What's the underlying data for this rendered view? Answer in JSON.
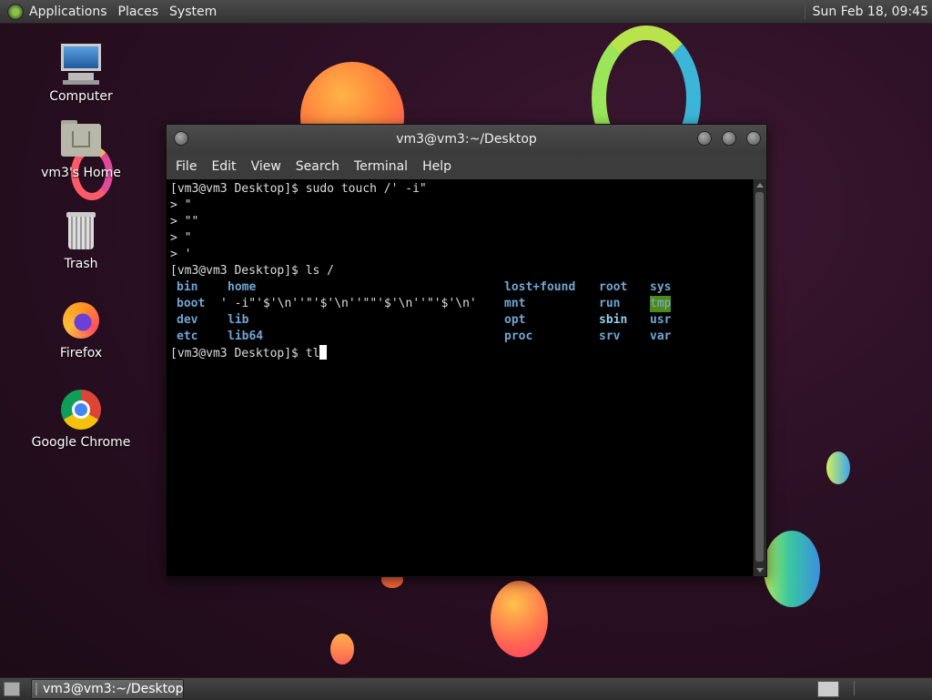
{
  "top_panel": {
    "menus": [
      "Applications",
      "Places",
      "System"
    ],
    "clock": "Sun Feb 18, 09:45"
  },
  "desktop_icons": [
    {
      "label": "Computer",
      "icon": "computer-icon"
    },
    {
      "label": "vm3's Home",
      "icon": "home-folder-icon"
    },
    {
      "label": "Trash",
      "icon": "trash-icon"
    },
    {
      "label": "Firefox",
      "icon": "firefox-icon"
    },
    {
      "label": "Google Chrome",
      "icon": "chrome-icon"
    }
  ],
  "terminal": {
    "title": "vm3@vm3:~/Desktop",
    "menu": [
      "File",
      "Edit",
      "View",
      "Search",
      "Terminal",
      "Help"
    ],
    "lines": [
      "[vm3@vm3 Desktop]$ sudo touch /' -i\"",
      "> \"",
      "> \"\"",
      "> \"",
      "> '",
      "[vm3@vm3 Desktop]$ ls /"
    ],
    "ls_output": {
      "col1": [
        "bin",
        "boot",
        "dev",
        "etc"
      ],
      "col2": [
        "home",
        "' -i\"'$'\\n''\"'$'\\n''\"\"'$'\\n''\"'$'\\n'",
        "lib",
        "lib64"
      ],
      "col3": [
        "lost+found",
        "mnt",
        "opt",
        "proc"
      ],
      "col4": [
        "root",
        "run",
        "sbin",
        "srv"
      ],
      "col5": [
        "sys",
        "tmp",
        "usr",
        "var"
      ]
    },
    "prompt_line": "[vm3@vm3 Desktop]$ tl"
  },
  "bottom_panel": {
    "task_label": "vm3@vm3:~/Desktop"
  },
  "colors": {
    "dir_blue": "#6fa7d4",
    "tmp_highlight": "#4e8a1a",
    "terminal_bg": "#000000"
  }
}
